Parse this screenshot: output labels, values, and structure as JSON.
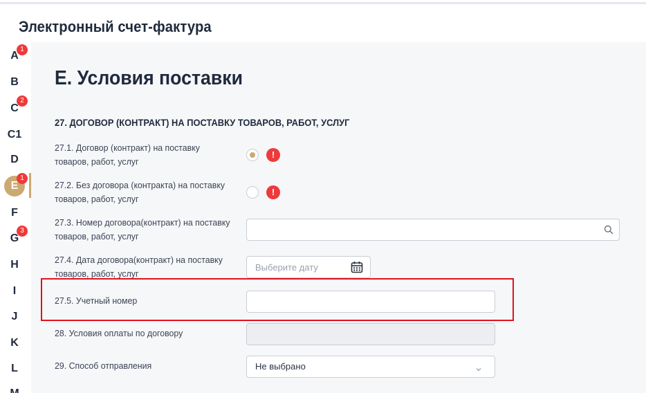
{
  "header": {
    "title": "Электронный счет-фактура"
  },
  "sidebar": {
    "items": [
      {
        "letter": "A",
        "badge": "1",
        "active": false
      },
      {
        "letter": "B",
        "badge": "",
        "active": false
      },
      {
        "letter": "C",
        "badge": "2",
        "active": false
      },
      {
        "letter": "C1",
        "badge": "",
        "active": false
      },
      {
        "letter": "D",
        "badge": "",
        "active": false
      },
      {
        "letter": "E",
        "badge": "1",
        "active": true
      },
      {
        "letter": "F",
        "badge": "",
        "active": false
      },
      {
        "letter": "G",
        "badge": "3",
        "active": false
      },
      {
        "letter": "H",
        "badge": "",
        "active": false
      },
      {
        "letter": "I",
        "badge": "",
        "active": false
      },
      {
        "letter": "J",
        "badge": "",
        "active": false
      },
      {
        "letter": "K",
        "badge": "",
        "active": false
      },
      {
        "letter": "L",
        "badge": "",
        "active": false
      },
      {
        "letter": "M",
        "badge": "",
        "active": false
      }
    ]
  },
  "main": {
    "section_title": "E. Условия поставки",
    "subsection_title": "27. ДОГОВОР (КОНТРАКТ) НА ПОСТАВКУ ТОВАРОВ, РАБОТ, УСЛУГ",
    "fields": {
      "f27_1": {
        "label": "27.1. Договор (контракт) на поставку товаров, работ, услуг",
        "checked": true,
        "warning": "!"
      },
      "f27_2": {
        "label": "27.2. Без договора (контракта) на поставку товаров, работ, услуг",
        "checked": false,
        "warning": "!"
      },
      "f27_3": {
        "label": "27.3. Номер договора(контракт) на поставку товаров, работ, услуг",
        "value": "",
        "icon": "search-icon"
      },
      "f27_4": {
        "label": "27.4. Дата договора(контракт) на поставку товаров, работ, услуг",
        "placeholder": "Выберите дату",
        "icon": "calendar-icon"
      },
      "f27_5": {
        "label": "27.5. Учетный номер",
        "value": ""
      },
      "f28": {
        "label": "28. Условия оплаты по договору",
        "value": "",
        "disabled": true
      },
      "f29": {
        "label": "29. Способ отправления",
        "value": "Не выбрано",
        "icon": "chevron-down-icon"
      }
    }
  },
  "colors": {
    "accent": "#cca970",
    "badge": "#ee3a3a",
    "highlight": "#e2101d",
    "content_bg": "#f6f7f9"
  }
}
